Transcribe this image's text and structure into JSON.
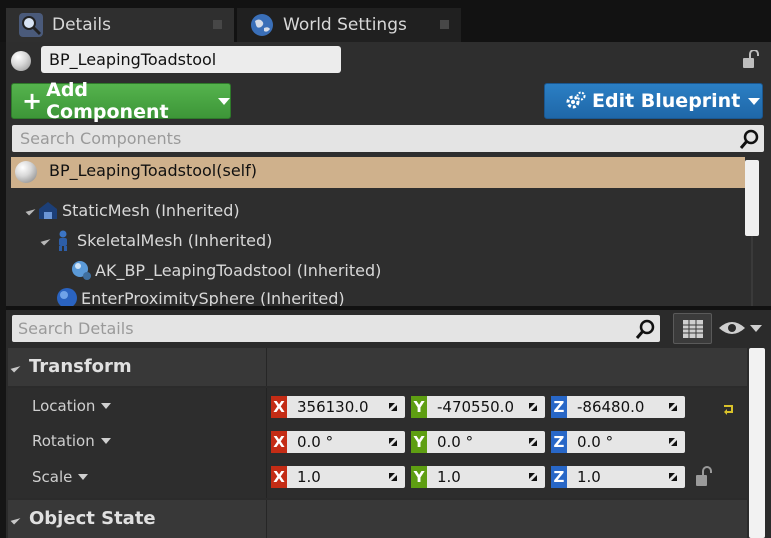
{
  "tabs": [
    {
      "label": "Details",
      "icon": "details-search-icon",
      "active": true
    },
    {
      "label": "World Settings",
      "icon": "globe-icon",
      "active": false
    }
  ],
  "actor_name": "BP_LeapingToadstool",
  "toolbar": {
    "add_component_label": "Add Component",
    "edit_blueprint_label": "Edit Blueprint"
  },
  "components_search": {
    "placeholder": "Search Components"
  },
  "components": [
    {
      "label": "BP_LeapingToadstool(self)",
      "icon": "actor-sphere-icon",
      "selected": true
    },
    {
      "label": "StaticMesh (Inherited)",
      "icon": "static-mesh-icon"
    },
    {
      "label": "SkeletalMesh (Inherited)",
      "icon": "skeletal-mesh-icon"
    },
    {
      "label": "AK_BP_LeapingToadstool (Inherited)",
      "icon": "audio-component-icon"
    },
    {
      "label": "EnterProximitySphere (Inherited)",
      "icon": "sphere-collision-icon"
    }
  ],
  "details_search": {
    "placeholder": "Search Details"
  },
  "sections": {
    "transform": "Transform",
    "object_state": "Object State"
  },
  "transform": {
    "location": {
      "label": "Location",
      "x": "356130.0",
      "y": "-470550.0",
      "z": "-86480.0"
    },
    "rotation": {
      "label": "Rotation",
      "x": "0.0 °",
      "y": "0.0 °",
      "z": "0.0 °"
    },
    "scale": {
      "label": "Scale",
      "x": "1.0",
      "y": "1.0",
      "z": "1.0"
    }
  },
  "axis_letters": {
    "x": "X",
    "y": "Y",
    "z": "Z"
  },
  "colors": {
    "add_component": "#4aa542",
    "edit_blueprint": "#2773b8",
    "selected_row": "#cfb18c",
    "axis_x": "#c42c15",
    "axis_y": "#5e9e12",
    "axis_z": "#2867c7"
  }
}
